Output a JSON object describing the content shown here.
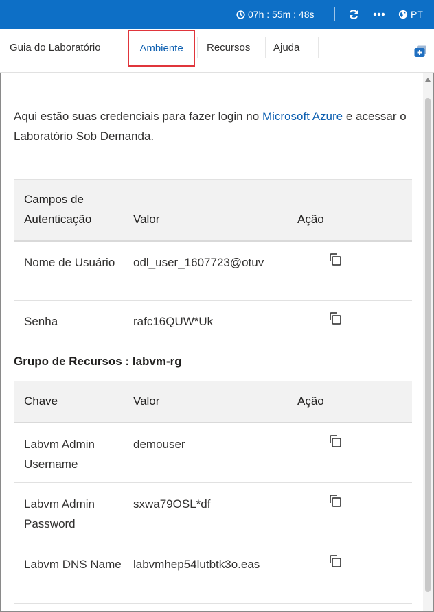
{
  "topbar": {
    "timer": "07h : 55m : 48s",
    "language": "PT",
    "accent": "#0d6fc6"
  },
  "tabs": {
    "items": [
      "Guia do Laboratório",
      "Ambiente",
      "Recursos",
      "Ajuda"
    ],
    "active": "Ambiente"
  },
  "intro": {
    "before": "Aqui estão suas credenciais para fazer login no ",
    "link": "Microsoft Azure",
    "after": " e acessar o Laboratório Sob Demanda."
  },
  "credentials": {
    "headers": [
      "Campos de Autenticação",
      "Valor",
      "Ação"
    ],
    "rows": [
      {
        "field": "Nome de Usuário",
        "value": "odl_user_1607723@otuv"
      },
      {
        "field": "Senha",
        "value": "rafc16QUW*Uk"
      }
    ]
  },
  "resource_group": {
    "title": "Grupo de Recursos : labvm-rg",
    "headers": [
      "Chave",
      "Valor",
      "Ação"
    ],
    "rows": [
      {
        "key": "Labvm Admin Username",
        "value": "demouser"
      },
      {
        "key": "Labvm Admin Password",
        "value": "sxwa79OSL*df"
      },
      {
        "key": "Labvm DNS Name",
        "value": "labvmhep54lutbtk3o.eas"
      }
    ]
  }
}
